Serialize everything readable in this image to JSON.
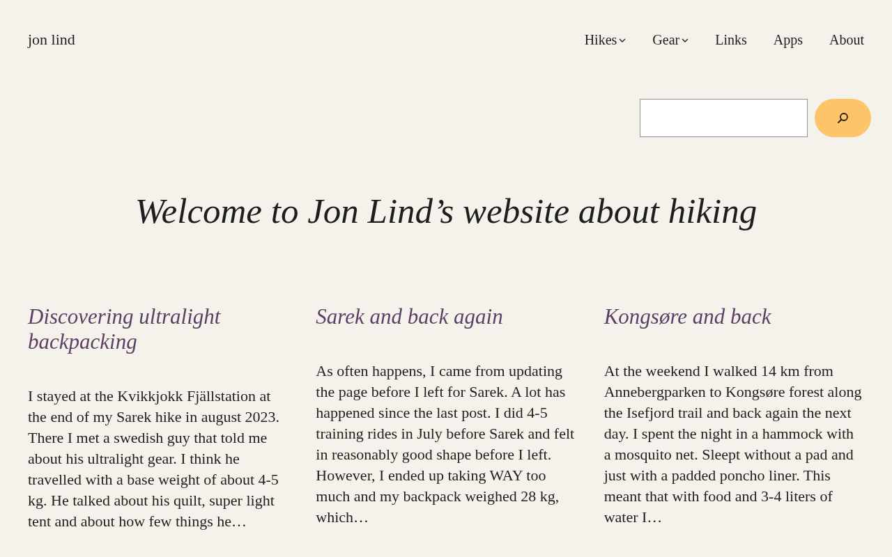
{
  "site_title": "jon lind",
  "nav": [
    {
      "label": "Hikes",
      "has_submenu": true
    },
    {
      "label": "Gear",
      "has_submenu": true
    },
    {
      "label": "Links",
      "has_submenu": false
    },
    {
      "label": "Apps",
      "has_submenu": false
    },
    {
      "label": "About",
      "has_submenu": false
    }
  ],
  "heading": "Welcome to Jon Lind’s website about hiking",
  "posts": [
    {
      "title": "Discovering ultralight backpacking",
      "excerpt": "I stayed at the Kvikkjokk Fjällstation at the end of my Sarek hike in august 2023. There I met a swedish guy that told me about his ultralight gear. I think he travelled with a base weight of about 4-5 kg. He talked about his quilt, super light tent and about how few things he…"
    },
    {
      "title": "Sarek and back again",
      "excerpt": "As often happens, I came from updating the page before I left for Sarek. A lot has happened since the last post. I did 4-5 training rides in July before Sarek and felt in reasonably good shape before I left. However, I ended up taking WAY too much and my backpack weighed 28 kg, which…"
    },
    {
      "title": "Kongsøre and back",
      "excerpt": "At the weekend I walked 14 km from Annebergparken to Kongsøre forest along the Isefjord trail and back again the next day. I spent the night in a hammock with a mosquito net. Sleept without a pad and just with a padded poncho liner. This meant that with food and 3-4 liters of water I…"
    }
  ]
}
